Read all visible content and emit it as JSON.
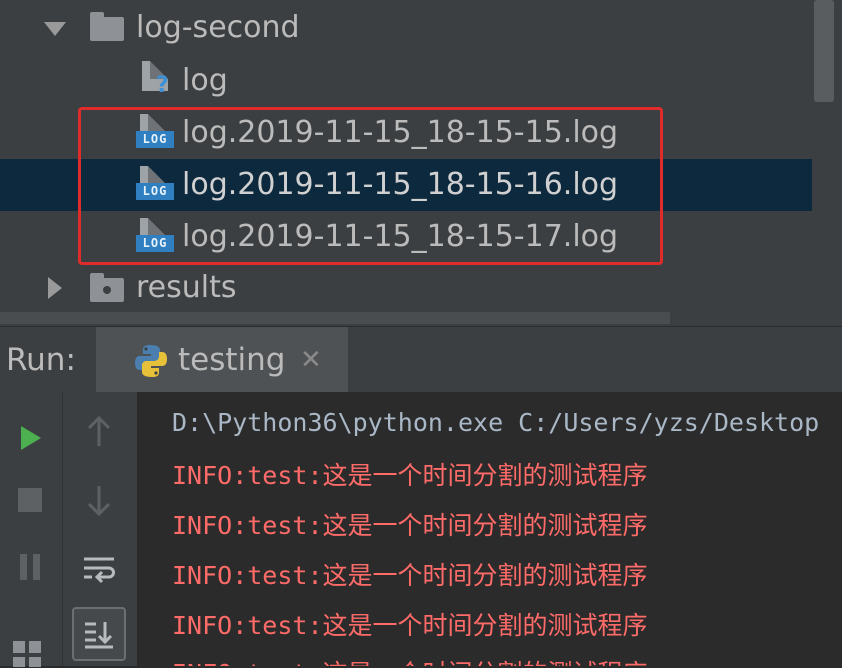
{
  "tree": {
    "folder_label": "log-second",
    "file_log": "log",
    "files": [
      "log.2019-11-15_18-15-15.log",
      "log.2019-11-15_18-15-16.log",
      "log.2019-11-15_18-15-17.log"
    ],
    "results_label": "results",
    "log_badge": "LOG",
    "question_mark": "?"
  },
  "run": {
    "label": "Run:",
    "tab_label": "testing",
    "close_glyph": "✕"
  },
  "console": {
    "command": "D:\\Python36\\python.exe C:/Users/yzs/Desktop",
    "lines": [
      "INFO:test:这是一个时间分割的测试程序",
      "INFO:test:这是一个时间分割的测试程序",
      "INFO:test:这是一个时间分割的测试程序",
      "INFO:test:这是一个时间分割的测试程序",
      "INFO:test:这是一个时间分割的测试程序"
    ]
  },
  "colors": {
    "highlight": "#e02b2b",
    "selection": "#0d293e",
    "info_text": "#ff6b68",
    "run_green": "#4caf50"
  }
}
